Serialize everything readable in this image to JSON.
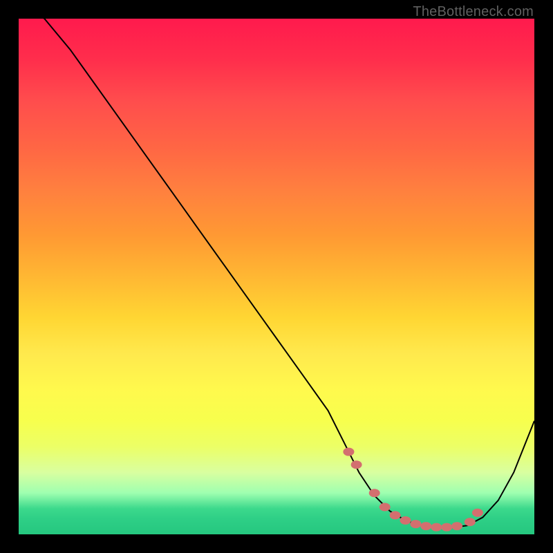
{
  "watermark": {
    "text": "TheBottleneck.com"
  },
  "chart_data": {
    "type": "line",
    "title": "",
    "xlabel": "",
    "ylabel": "",
    "xlim": [
      0,
      100
    ],
    "ylim": [
      0,
      100
    ],
    "grid": false,
    "series": [
      {
        "name": "curve",
        "x": [
          0,
          5,
          10,
          15,
          20,
          25,
          30,
          35,
          40,
          45,
          50,
          55,
          60,
          63,
          66,
          69,
          72,
          75,
          78,
          81,
          84,
          87,
          90,
          93,
          96,
          100
        ],
        "values": [
          103,
          100,
          94,
          87,
          80,
          73,
          66,
          59,
          52,
          45,
          38,
          31,
          24,
          18,
          12,
          7.5,
          4.5,
          2.7,
          1.7,
          1.3,
          1.3,
          1.7,
          3.3,
          6.6,
          12,
          22
        ],
        "color": "#000000"
      },
      {
        "name": "markers",
        "type": "scatter",
        "x": [
          64,
          65.5,
          69,
          71,
          73,
          75,
          77,
          79,
          81,
          83,
          85,
          87.5,
          89
        ],
        "values": [
          16,
          13.5,
          8,
          5.3,
          3.7,
          2.7,
          2.0,
          1.6,
          1.4,
          1.4,
          1.6,
          2.4,
          4.2
        ],
        "color": "#d36f6f"
      }
    ],
    "background_gradient": {
      "direction": "top-to-bottom",
      "stops": [
        {
          "pos": 0.0,
          "color": "#ff1a4d"
        },
        {
          "pos": 0.33,
          "color": "#ff7f3f"
        },
        {
          "pos": 0.65,
          "color": "#ffe94d"
        },
        {
          "pos": 0.95,
          "color": "#3cd98c"
        },
        {
          "pos": 1.0,
          "color": "#25c77f"
        }
      ]
    }
  }
}
